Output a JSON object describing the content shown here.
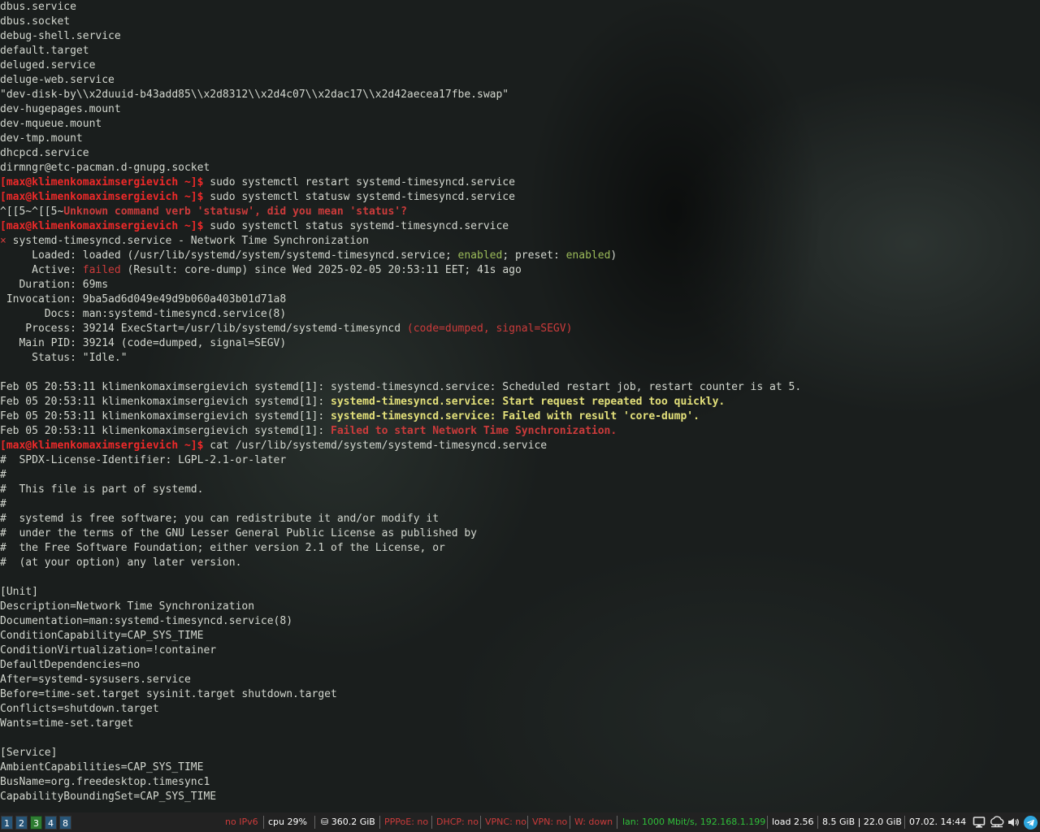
{
  "terminal": {
    "lines": [
      [
        {
          "t": "dbus.service"
        }
      ],
      [
        {
          "t": "dbus.socket"
        }
      ],
      [
        {
          "t": "debug-shell.service"
        }
      ],
      [
        {
          "t": "default.target"
        }
      ],
      [
        {
          "t": "deluged.service"
        }
      ],
      [
        {
          "t": "deluge-web.service"
        }
      ],
      [
        {
          "t": "\"dev-disk-by\\\\x2duuid-b43add85\\\\x2d8312\\\\x2d4c07\\\\x2dac17\\\\x2d42aecea17fbe.swap\""
        }
      ],
      [
        {
          "t": "dev-hugepages.mount"
        }
      ],
      [
        {
          "t": "dev-mqueue.mount"
        }
      ],
      [
        {
          "t": "dev-tmp.mount"
        }
      ],
      [
        {
          "t": "dhcpcd.service"
        }
      ],
      [
        {
          "t": "dirmngr@etc-pacman.d-gnupg.socket"
        }
      ],
      [
        {
          "t": "[max@klimenkomaximsergievich ~]$",
          "c": "prompt"
        },
        {
          "t": " sudo systemctl restart systemd-timesyncd.service"
        }
      ],
      [
        {
          "t": "[max@klimenkomaximsergievich ~]$",
          "c": "prompt"
        },
        {
          "t": " sudo systemctl statusw systemd-timesyncd.service"
        }
      ],
      [
        {
          "t": "^[[5~^[[5~"
        },
        {
          "t": "Unknown command verb 'statusw', did you mean 'status'?",
          "c": "redb"
        }
      ],
      [
        {
          "t": "[max@klimenkomaximsergievich ~]$",
          "c": "prompt"
        },
        {
          "t": " sudo systemctl status systemd-timesyncd.service"
        }
      ],
      [
        {
          "t": "×",
          "c": "x"
        },
        {
          "t": " systemd-timesyncd.service - Network Time Synchronization"
        }
      ],
      [
        {
          "t": "     Loaded: loaded (/usr/lib/systemd/system/systemd-timesyncd.service; "
        },
        {
          "t": "enabled",
          "c": "green"
        },
        {
          "t": "; preset: "
        },
        {
          "t": "enabled",
          "c": "green"
        },
        {
          "t": ")"
        }
      ],
      [
        {
          "t": "     Active: "
        },
        {
          "t": "failed",
          "c": "red"
        },
        {
          "t": " (Result: core-dump) since Wed 2025-02-05 20:53:11 EET; 41s ago"
        }
      ],
      [
        {
          "t": "   Duration: 69ms"
        }
      ],
      [
        {
          "t": " Invocation: 9ba5ad6d049e49d9b060a403b01d71a8"
        }
      ],
      [
        {
          "t": "       Docs: man:systemd-timesyncd.service(8)"
        }
      ],
      [
        {
          "t": "    Process: 39214 ExecStart=/usr/lib/systemd/systemd-timesyncd "
        },
        {
          "t": "(code=dumped, signal=SEGV)",
          "c": "red"
        }
      ],
      [
        {
          "t": "   Main PID: 39214 (code=dumped, signal=SEGV)"
        }
      ],
      [
        {
          "t": "     Status: \"Idle.\""
        }
      ],
      [
        {
          "t": ""
        }
      ],
      [
        {
          "t": "Feb 05 20:53:11 klimenkomaximsergievich systemd[1]: systemd-timesyncd.service: Scheduled restart job, restart counter is at 5."
        }
      ],
      [
        {
          "t": "Feb 05 20:53:11 klimenkomaximsergievich systemd[1]: "
        },
        {
          "t": "systemd-timesyncd.service: Start request repeated too quickly.",
          "c": "yellowb"
        }
      ],
      [
        {
          "t": "Feb 05 20:53:11 klimenkomaximsergievich systemd[1]: "
        },
        {
          "t": "systemd-timesyncd.service: Failed with result 'core-dump'.",
          "c": "yellowb"
        }
      ],
      [
        {
          "t": "Feb 05 20:53:11 klimenkomaximsergievich systemd[1]: "
        },
        {
          "t": "Failed to start Network Time Synchronization.",
          "c": "redb"
        }
      ],
      [
        {
          "t": "[max@klimenkomaximsergievich ~]$",
          "c": "prompt"
        },
        {
          "t": " cat /usr/lib/systemd/system/systemd-timesyncd.service"
        }
      ],
      [
        {
          "t": "#  SPDX-License-Identifier: LGPL-2.1-or-later"
        }
      ],
      [
        {
          "t": "#"
        }
      ],
      [
        {
          "t": "#  This file is part of systemd."
        }
      ],
      [
        {
          "t": "#"
        }
      ],
      [
        {
          "t": "#  systemd is free software; you can redistribute it and/or modify it"
        }
      ],
      [
        {
          "t": "#  under the terms of the GNU Lesser General Public License as published by"
        }
      ],
      [
        {
          "t": "#  the Free Software Foundation; either version 2.1 of the License, or"
        }
      ],
      [
        {
          "t": "#  (at your option) any later version."
        }
      ],
      [
        {
          "t": ""
        }
      ],
      [
        {
          "t": "[Unit]"
        }
      ],
      [
        {
          "t": "Description=Network Time Synchronization"
        }
      ],
      [
        {
          "t": "Documentation=man:systemd-timesyncd.service(8)"
        }
      ],
      [
        {
          "t": "ConditionCapability=CAP_SYS_TIME"
        }
      ],
      [
        {
          "t": "ConditionVirtualization=!container"
        }
      ],
      [
        {
          "t": "DefaultDependencies=no"
        }
      ],
      [
        {
          "t": "After=systemd-sysusers.service"
        }
      ],
      [
        {
          "t": "Before=time-set.target sysinit.target shutdown.target"
        }
      ],
      [
        {
          "t": "Conflicts=shutdown.target"
        }
      ],
      [
        {
          "t": "Wants=time-set.target"
        }
      ],
      [
        {
          "t": ""
        }
      ],
      [
        {
          "t": "[Service]"
        }
      ],
      [
        {
          "t": "AmbientCapabilities=CAP_SYS_TIME"
        }
      ],
      [
        {
          "t": "BusName=org.freedesktop.timesync1"
        }
      ],
      [
        {
          "t": "CapabilityBoundingSet=CAP_SYS_TIME"
        }
      ]
    ]
  },
  "statusbar": {
    "workspaces": [
      {
        "label": "1",
        "active": false
      },
      {
        "label": "2",
        "active": false
      },
      {
        "label": "3",
        "active": true
      },
      {
        "label": "4",
        "active": false
      },
      {
        "label": "8",
        "active": false
      }
    ],
    "blocks": {
      "ipv6": {
        "text": "no IPv6",
        "color": "#cc3b3b"
      },
      "cpu": {
        "text": "cpu  29%",
        "color": "#ffffff"
      },
      "disk": {
        "text": "⛁ 360.2 GiB",
        "color": "#ffffff"
      },
      "pppoe": {
        "text": "PPPoE: no",
        "color": "#cc3b3b"
      },
      "dhcp": {
        "text": "DHCP: no",
        "color": "#cc3b3b"
      },
      "vpnc": {
        "text": "VPNC: no",
        "color": "#cc3b3b"
      },
      "vpn": {
        "text": "VPN: no",
        "color": "#cc3b3b"
      },
      "wifi": {
        "text": "W: down",
        "color": "#cc3b3b"
      },
      "lan": {
        "text": "lan: 1000 Mbit/s, 192.168.1.199",
        "color": "#2fbf3a"
      },
      "load": {
        "text": "load 2.56",
        "color": "#ffffff"
      },
      "memory": {
        "text": "8.5 GiB | 22.0 GiB",
        "color": "#ffffff"
      },
      "clock": {
        "text": "07.02. 14:44",
        "color": "#ffffff"
      }
    },
    "tray_icons": [
      "monitor-icon",
      "network-icon",
      "volume-icon",
      "telegram-icon"
    ]
  }
}
